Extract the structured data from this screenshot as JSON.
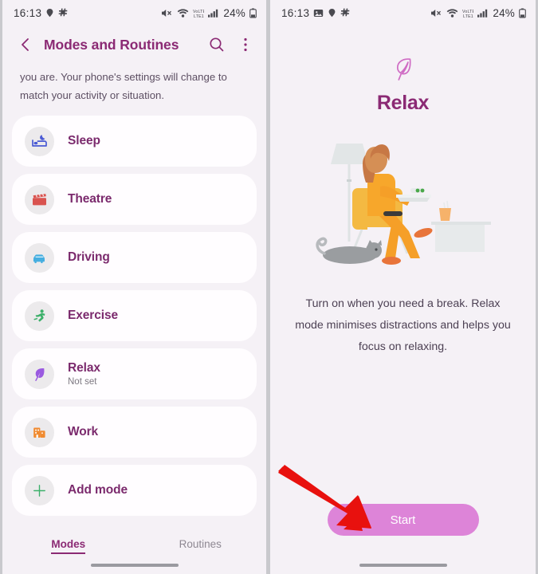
{
  "colors": {
    "accent_purple": "#8b2a74",
    "card_bg": "#fffdff",
    "screen_bg": "#f5f1f6",
    "start_button": "#dd84d8",
    "arrow_red": "#e8110e"
  },
  "left_phone": {
    "status_bar": {
      "time": "16:13",
      "left_icons": [
        "location-icon",
        "samsung-pay-icon"
      ],
      "right_icons": [
        "mute-icon",
        "wifi-icon",
        "volte-icon",
        "signal-icon"
      ],
      "battery_percent": "24%",
      "battery_icon": "battery-icon"
    },
    "app_bar": {
      "back_icon": "back-chevron-icon",
      "title": "Modes and Routines",
      "search_icon": "search-icon",
      "more_icon": "more-vertical-icon"
    },
    "intro_text": "you are. Your phone's settings will change to match your activity or situation.",
    "modes": [
      {
        "name": "Sleep",
        "subtitle": "",
        "icon": "bed-icon",
        "icon_color": "#4a5ad4"
      },
      {
        "name": "Theatre",
        "subtitle": "",
        "icon": "clapperboard-icon",
        "icon_color": "#d9534f"
      },
      {
        "name": "Driving",
        "subtitle": "",
        "icon": "car-icon",
        "icon_color": "#45aee0"
      },
      {
        "name": "Exercise",
        "subtitle": "",
        "icon": "runner-icon",
        "icon_color": "#3cb06a"
      },
      {
        "name": "Relax",
        "subtitle": "Not set",
        "icon": "leaf-icon",
        "icon_color": "#9a5ae0"
      },
      {
        "name": "Work",
        "subtitle": "",
        "icon": "office-building-icon",
        "icon_color": "#f08a30"
      },
      {
        "name": "Add mode",
        "subtitle": "",
        "icon": "plus-icon",
        "icon_color": "#3cb06a"
      }
    ],
    "tabs": [
      {
        "label": "Modes",
        "active": true
      },
      {
        "label": "Routines",
        "active": false
      }
    ]
  },
  "right_phone": {
    "status_bar": {
      "time": "16:13",
      "left_icons": [
        "screenshot-icon",
        "location-icon",
        "samsung-pay-icon"
      ],
      "right_icons": [
        "mute-icon",
        "wifi-icon",
        "volte-icon",
        "signal-icon"
      ],
      "battery_percent": "24%",
      "battery_icon": "battery-icon"
    },
    "header_icon": "leaf-icon",
    "title": "Relax",
    "illustration": "woman-relaxing-in-chair-with-cat-illustration",
    "description": "Turn on when you need a break. Relax mode minimises distractions and helps you focus on relaxing.",
    "start_button_label": "Start"
  },
  "annotation": {
    "arrow": "red-arrow-pointing-to-start-button"
  }
}
